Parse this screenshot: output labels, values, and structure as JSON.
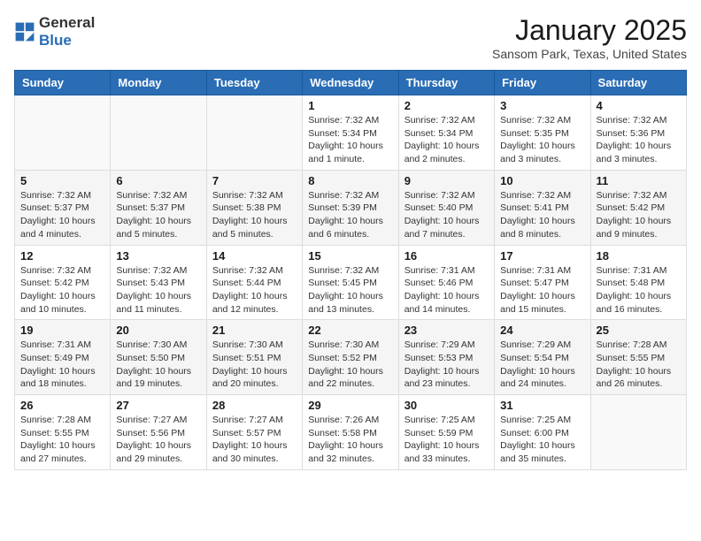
{
  "header": {
    "logo_general": "General",
    "logo_blue": "Blue",
    "title": "January 2025",
    "subtitle": "Sansom Park, Texas, United States"
  },
  "calendar": {
    "weekdays": [
      "Sunday",
      "Monday",
      "Tuesday",
      "Wednesday",
      "Thursday",
      "Friday",
      "Saturday"
    ],
    "weeks": [
      [
        {
          "day": "",
          "info": ""
        },
        {
          "day": "",
          "info": ""
        },
        {
          "day": "",
          "info": ""
        },
        {
          "day": "1",
          "info": "Sunrise: 7:32 AM\nSunset: 5:34 PM\nDaylight: 10 hours\nand 1 minute."
        },
        {
          "day": "2",
          "info": "Sunrise: 7:32 AM\nSunset: 5:34 PM\nDaylight: 10 hours\nand 2 minutes."
        },
        {
          "day": "3",
          "info": "Sunrise: 7:32 AM\nSunset: 5:35 PM\nDaylight: 10 hours\nand 3 minutes."
        },
        {
          "day": "4",
          "info": "Sunrise: 7:32 AM\nSunset: 5:36 PM\nDaylight: 10 hours\nand 3 minutes."
        }
      ],
      [
        {
          "day": "5",
          "info": "Sunrise: 7:32 AM\nSunset: 5:37 PM\nDaylight: 10 hours\nand 4 minutes."
        },
        {
          "day": "6",
          "info": "Sunrise: 7:32 AM\nSunset: 5:37 PM\nDaylight: 10 hours\nand 5 minutes."
        },
        {
          "day": "7",
          "info": "Sunrise: 7:32 AM\nSunset: 5:38 PM\nDaylight: 10 hours\nand 5 minutes."
        },
        {
          "day": "8",
          "info": "Sunrise: 7:32 AM\nSunset: 5:39 PM\nDaylight: 10 hours\nand 6 minutes."
        },
        {
          "day": "9",
          "info": "Sunrise: 7:32 AM\nSunset: 5:40 PM\nDaylight: 10 hours\nand 7 minutes."
        },
        {
          "day": "10",
          "info": "Sunrise: 7:32 AM\nSunset: 5:41 PM\nDaylight: 10 hours\nand 8 minutes."
        },
        {
          "day": "11",
          "info": "Sunrise: 7:32 AM\nSunset: 5:42 PM\nDaylight: 10 hours\nand 9 minutes."
        }
      ],
      [
        {
          "day": "12",
          "info": "Sunrise: 7:32 AM\nSunset: 5:42 PM\nDaylight: 10 hours\nand 10 minutes."
        },
        {
          "day": "13",
          "info": "Sunrise: 7:32 AM\nSunset: 5:43 PM\nDaylight: 10 hours\nand 11 minutes."
        },
        {
          "day": "14",
          "info": "Sunrise: 7:32 AM\nSunset: 5:44 PM\nDaylight: 10 hours\nand 12 minutes."
        },
        {
          "day": "15",
          "info": "Sunrise: 7:32 AM\nSunset: 5:45 PM\nDaylight: 10 hours\nand 13 minutes."
        },
        {
          "day": "16",
          "info": "Sunrise: 7:31 AM\nSunset: 5:46 PM\nDaylight: 10 hours\nand 14 minutes."
        },
        {
          "day": "17",
          "info": "Sunrise: 7:31 AM\nSunset: 5:47 PM\nDaylight: 10 hours\nand 15 minutes."
        },
        {
          "day": "18",
          "info": "Sunrise: 7:31 AM\nSunset: 5:48 PM\nDaylight: 10 hours\nand 16 minutes."
        }
      ],
      [
        {
          "day": "19",
          "info": "Sunrise: 7:31 AM\nSunset: 5:49 PM\nDaylight: 10 hours\nand 18 minutes."
        },
        {
          "day": "20",
          "info": "Sunrise: 7:30 AM\nSunset: 5:50 PM\nDaylight: 10 hours\nand 19 minutes."
        },
        {
          "day": "21",
          "info": "Sunrise: 7:30 AM\nSunset: 5:51 PM\nDaylight: 10 hours\nand 20 minutes."
        },
        {
          "day": "22",
          "info": "Sunrise: 7:30 AM\nSunset: 5:52 PM\nDaylight: 10 hours\nand 22 minutes."
        },
        {
          "day": "23",
          "info": "Sunrise: 7:29 AM\nSunset: 5:53 PM\nDaylight: 10 hours\nand 23 minutes."
        },
        {
          "day": "24",
          "info": "Sunrise: 7:29 AM\nSunset: 5:54 PM\nDaylight: 10 hours\nand 24 minutes."
        },
        {
          "day": "25",
          "info": "Sunrise: 7:28 AM\nSunset: 5:55 PM\nDaylight: 10 hours\nand 26 minutes."
        }
      ],
      [
        {
          "day": "26",
          "info": "Sunrise: 7:28 AM\nSunset: 5:55 PM\nDaylight: 10 hours\nand 27 minutes."
        },
        {
          "day": "27",
          "info": "Sunrise: 7:27 AM\nSunset: 5:56 PM\nDaylight: 10 hours\nand 29 minutes."
        },
        {
          "day": "28",
          "info": "Sunrise: 7:27 AM\nSunset: 5:57 PM\nDaylight: 10 hours\nand 30 minutes."
        },
        {
          "day": "29",
          "info": "Sunrise: 7:26 AM\nSunset: 5:58 PM\nDaylight: 10 hours\nand 32 minutes."
        },
        {
          "day": "30",
          "info": "Sunrise: 7:25 AM\nSunset: 5:59 PM\nDaylight: 10 hours\nand 33 minutes."
        },
        {
          "day": "31",
          "info": "Sunrise: 7:25 AM\nSunset: 6:00 PM\nDaylight: 10 hours\nand 35 minutes."
        },
        {
          "day": "",
          "info": ""
        }
      ]
    ]
  }
}
